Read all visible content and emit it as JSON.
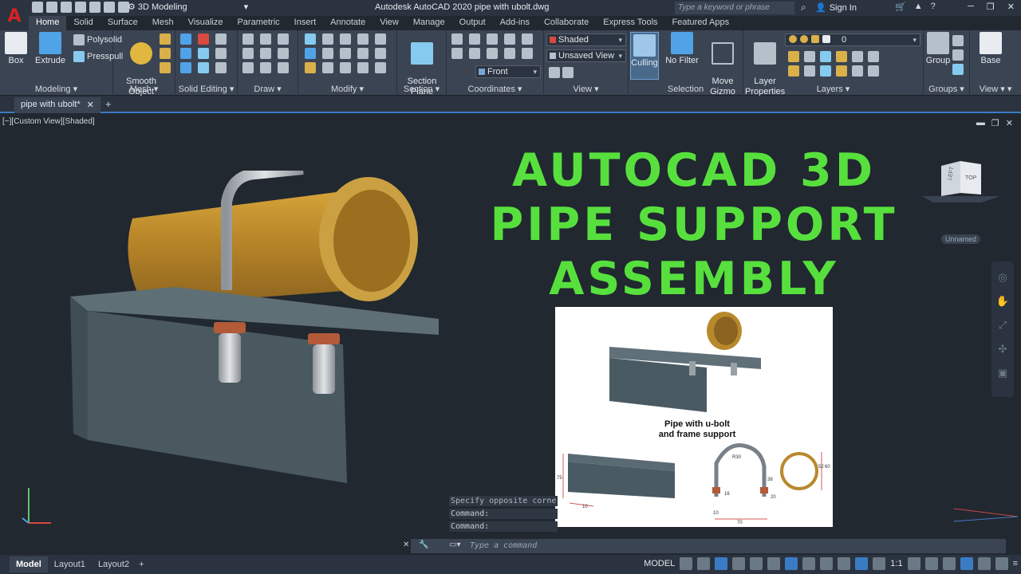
{
  "app": {
    "logo_letter": "A",
    "workspace": "3D Modeling",
    "title": "Autodesk AutoCAD 2020    pipe with ubolt.dwg",
    "search_placeholder": "Type a keyword or phrase",
    "sign_in": "Sign In"
  },
  "ribbon_tabs": [
    "Home",
    "Solid",
    "Surface",
    "Mesh",
    "Visualize",
    "Parametric",
    "Insert",
    "Annotate",
    "View",
    "Manage",
    "Output",
    "Add-ins",
    "Collaborate",
    "Express Tools",
    "Featured Apps"
  ],
  "ribbon": {
    "modeling": {
      "title": "Modeling",
      "box": "Box",
      "extrude": "Extrude",
      "polysolid": "Polysolid",
      "presspull": "Presspull"
    },
    "mesh": {
      "title": "Mesh",
      "smooth_object": "Smooth\nObject"
    },
    "solid_editing": {
      "title": "Solid Editing"
    },
    "draw": {
      "title": "Draw"
    },
    "modify": {
      "title": "Modify"
    },
    "section": {
      "title": "Section",
      "section_plane": "Section\nPlane"
    },
    "coordinates": {
      "title": "Coordinates",
      "ucs_dropdown": "Front"
    },
    "view": {
      "title": "View",
      "visual_style": "Shaded",
      "saved_view": "Unsaved View"
    },
    "selection": {
      "title": "Selection",
      "culling": "Culling",
      "no_filter": "No Filter",
      "move_gizmo": "Move\nGizmo"
    },
    "layers": {
      "title": "Layers",
      "layer_properties": "Layer\nProperties",
      "current_layer": "0"
    },
    "groups": {
      "title": "Groups",
      "group": "Group"
    },
    "view2": {
      "title": "View",
      "base": "Base"
    }
  },
  "document_tab": "pipe with ubolt*",
  "viewport": {
    "label": "[−][Custom View][Shaded]",
    "viewcube_left": "LEFT",
    "viewcube_top": "TOP",
    "ucs_name": "Unnamed"
  },
  "headline": [
    "AUTOCAD 3D",
    "PIPE SUPPORT",
    "ASSEMBLY"
  ],
  "inset": {
    "caption": "Pipe with u-bolt\nand frame support",
    "dims": [
      "75",
      "10",
      "R30",
      "38",
      "16",
      "20",
      "10",
      "70",
      "52",
      "60"
    ]
  },
  "command_history": [
    "Specify opposite corne",
    "Command:",
    "Command:"
  ],
  "command_placeholder": "Type a command",
  "layouts": [
    "Model",
    "Layout1",
    "Layout2"
  ],
  "status": {
    "mode": "MODEL",
    "scale": "1:1"
  }
}
